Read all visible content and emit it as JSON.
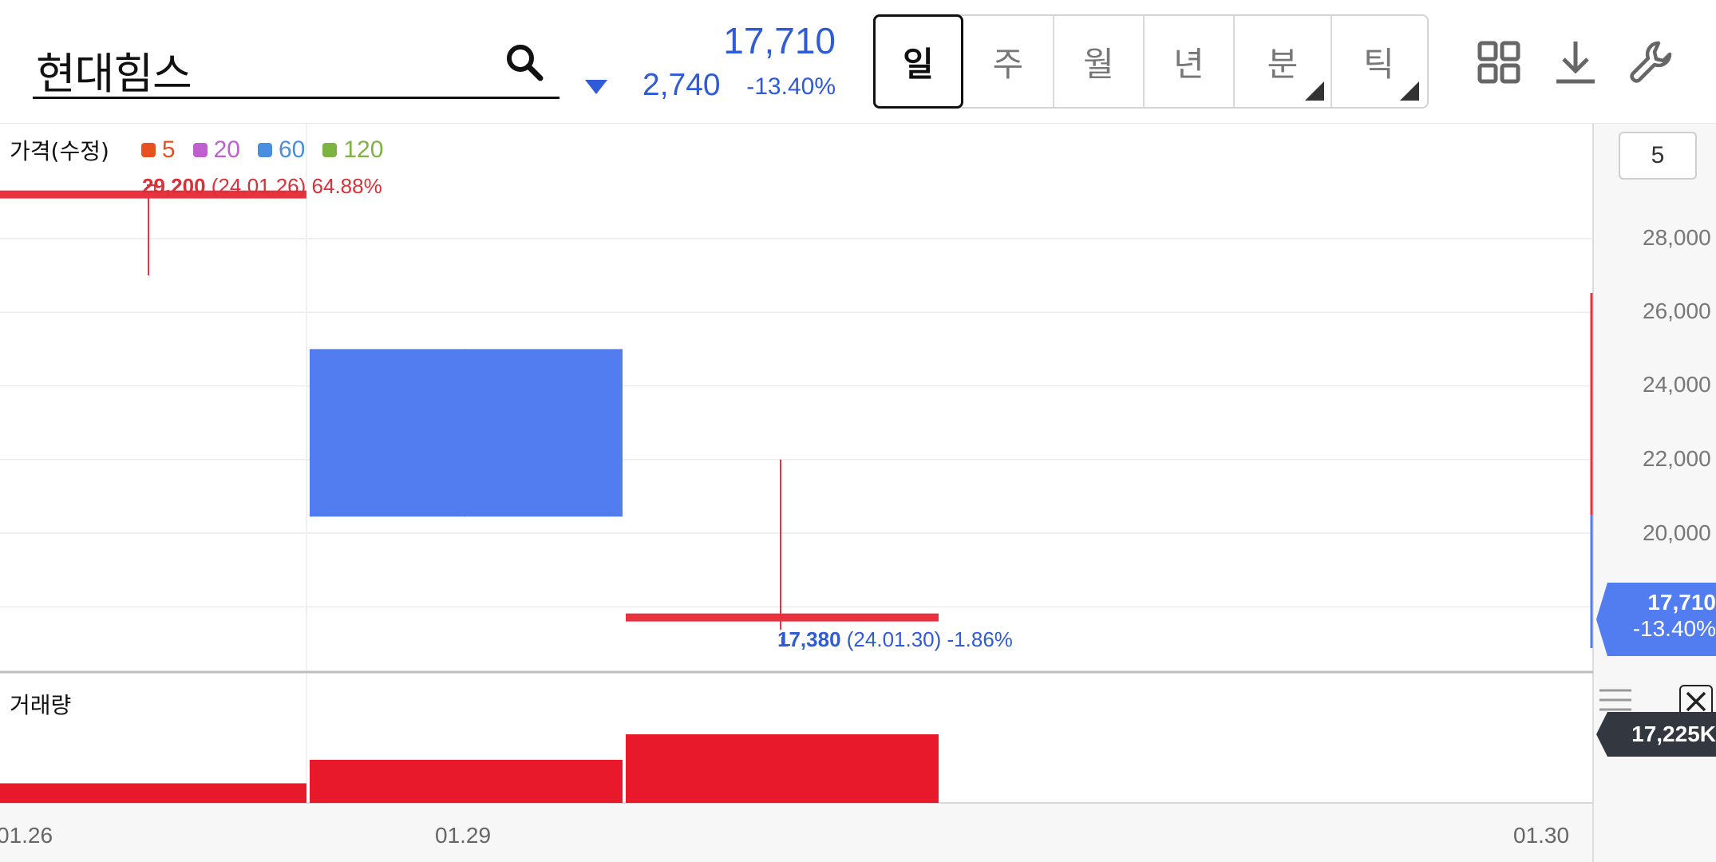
{
  "header": {
    "stock_name": "현대힘스",
    "price": "17,710",
    "change": "2,740",
    "change_rate": "-13.40%",
    "price_color": "#2f5bd6"
  },
  "periods": [
    {
      "label": "일",
      "active": true,
      "has_submenu": false
    },
    {
      "label": "주",
      "active": false,
      "has_submenu": false
    },
    {
      "label": "월",
      "active": false,
      "has_submenu": false
    },
    {
      "label": "년",
      "active": false,
      "has_submenu": false
    },
    {
      "label": "분",
      "active": false,
      "has_submenu": true
    },
    {
      "label": "틱",
      "active": false,
      "has_submenu": true
    }
  ],
  "toolbar_icons": [
    "grid-icon",
    "download-icon",
    "wrench-icon"
  ],
  "legend": {
    "title": "가격(수정)",
    "items": [
      {
        "label": "5",
        "color": "#e8501f"
      },
      {
        "label": "20",
        "color": "#c060d0"
      },
      {
        "label": "60",
        "color": "#4a8ee0"
      },
      {
        "label": "120",
        "color": "#7cb342"
      }
    ]
  },
  "annotations": {
    "max": {
      "price": "29,200",
      "date": "(24.01.26)",
      "rate": "64.88%"
    },
    "min": {
      "price": "17,380",
      "date": "(24.01.30)",
      "rate": "-1.86%"
    }
  },
  "ma_period": "5",
  "current_tag": {
    "price": "17,710",
    "rate": "-13.40%"
  },
  "volume": {
    "title": "거래량",
    "last_value": "17,225K"
  },
  "colors": {
    "up": "#e8323f",
    "down": "#527df0",
    "volume": "#e8192a"
  },
  "chart_data": {
    "type": "candlestick",
    "title": "",
    "y_tick_labels": [
      "28,000",
      "26,000",
      "24,000",
      "22,000",
      "20,000"
    ],
    "x_tick_labels": [
      "01.26",
      "01.29",
      "01.30"
    ],
    "ylim": [
      16300,
      29700
    ],
    "grid": true,
    "candles": [
      {
        "date": "01.26",
        "open": 29200,
        "high": 29200,
        "low": 27000,
        "close": 29200
      },
      {
        "date": "01.29",
        "open": 25000,
        "high": 25000,
        "low": 20450,
        "close": 20450
      },
      {
        "date": "01.30",
        "open": 17710,
        "high": 22000,
        "low": 17380,
        "close": 17710
      }
    ],
    "volumes": [
      500,
      1100,
      1750
    ]
  }
}
